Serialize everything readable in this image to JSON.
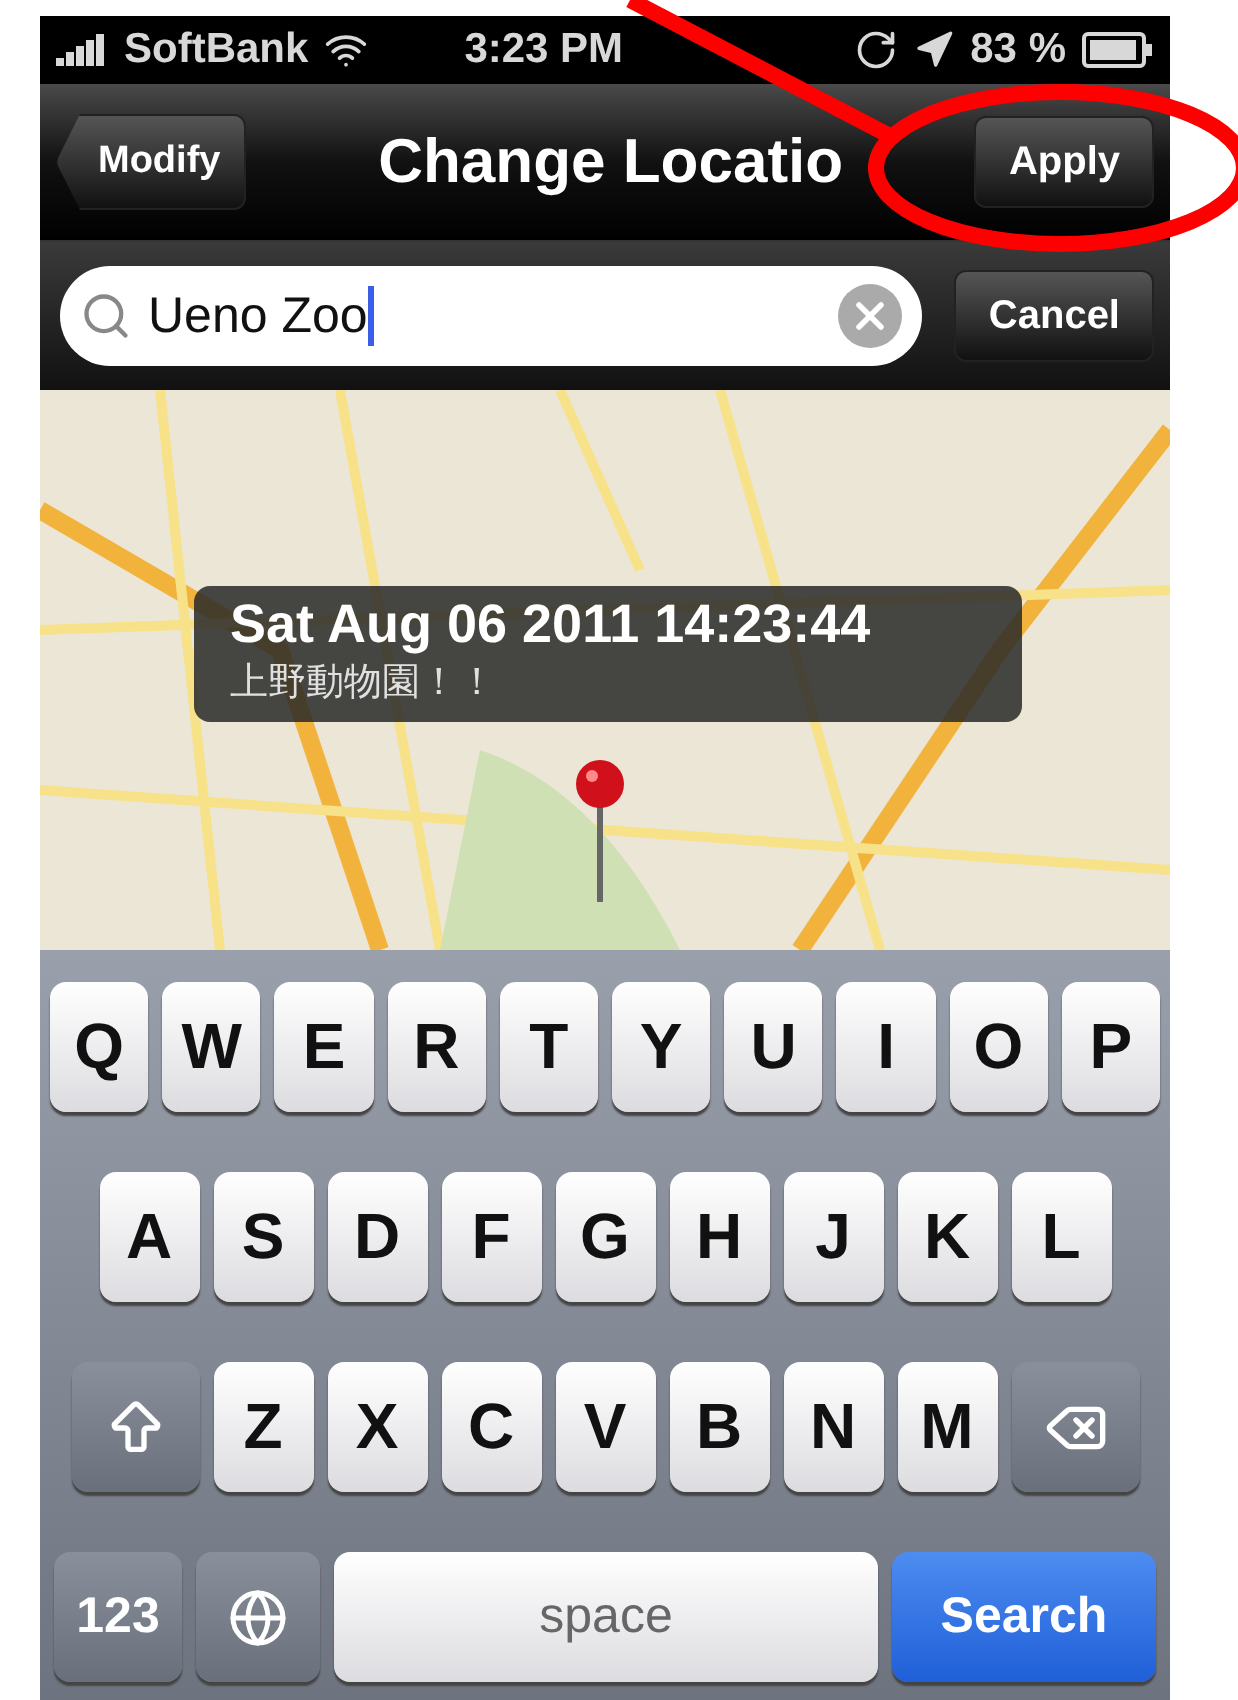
{
  "status_bar": {
    "carrier": "SoftBank",
    "time": "3:23 PM",
    "battery": "83 %"
  },
  "nav_bar": {
    "back": "Modify",
    "title": "Change Locatio",
    "action": "Apply"
  },
  "search": {
    "value": "Ueno Zoo",
    "cancel": "Cancel"
  },
  "callout": {
    "title": "Sat Aug 06 2011 14:23:44",
    "subtitle": "上野動物園！！"
  },
  "keyboard": {
    "rows": [
      {
        "keys": [
          {
            "kind": "letter",
            "label": "Q"
          },
          {
            "kind": "letter",
            "label": "W"
          },
          {
            "kind": "letter",
            "label": "E"
          },
          {
            "kind": "letter",
            "label": "R"
          },
          {
            "kind": "letter",
            "label": "T"
          },
          {
            "kind": "letter",
            "label": "Y"
          },
          {
            "kind": "letter",
            "label": "U"
          },
          {
            "kind": "letter",
            "label": "I"
          },
          {
            "kind": "letter",
            "label": "O"
          },
          {
            "kind": "letter",
            "label": "P"
          }
        ]
      },
      {
        "keys": [
          {
            "kind": "letter",
            "label": "A"
          },
          {
            "kind": "letter",
            "label": "S"
          },
          {
            "kind": "letter",
            "label": "D"
          },
          {
            "kind": "letter",
            "label": "F"
          },
          {
            "kind": "letter",
            "label": "G"
          },
          {
            "kind": "letter",
            "label": "H"
          },
          {
            "kind": "letter",
            "label": "J"
          },
          {
            "kind": "letter",
            "label": "K"
          },
          {
            "kind": "letter",
            "label": "L"
          }
        ]
      },
      {
        "keys": [
          {
            "kind": "shift"
          },
          {
            "kind": "letter",
            "label": "Z"
          },
          {
            "kind": "letter",
            "label": "X"
          },
          {
            "kind": "letter",
            "label": "C"
          },
          {
            "kind": "letter",
            "label": "V"
          },
          {
            "kind": "letter",
            "label": "B"
          },
          {
            "kind": "letter",
            "label": "N"
          },
          {
            "kind": "letter",
            "label": "M"
          },
          {
            "kind": "delete"
          }
        ]
      },
      {
        "keys": [
          {
            "kind": "mode",
            "label": "123"
          },
          {
            "kind": "globe"
          },
          {
            "kind": "space",
            "label": "space"
          },
          {
            "kind": "search",
            "label": "Search"
          }
        ]
      }
    ]
  }
}
